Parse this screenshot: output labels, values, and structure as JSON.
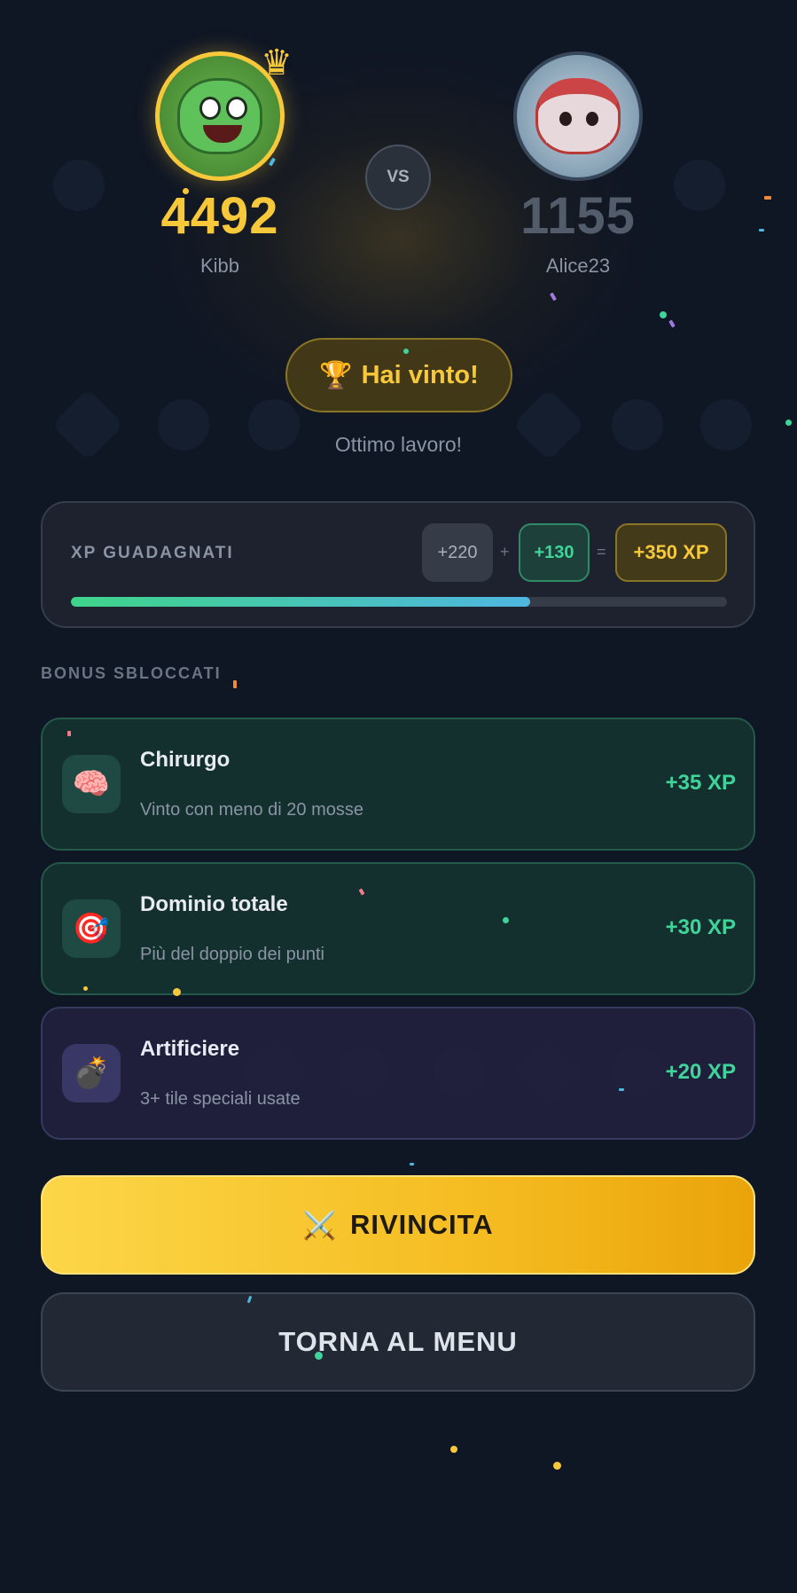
{
  "players": [
    {
      "name": "Kibb",
      "score": "4492",
      "avatar_icon": "frog-avatar-icon",
      "winner": true
    },
    {
      "name": "Alice23",
      "score": "1155",
      "avatar_icon": "mushroom-avatar-icon",
      "winner": false
    }
  ],
  "vs_label": "VS",
  "result": {
    "title": "Hai vinto!",
    "subtitle": "Ottimo lavoro!",
    "icon": "trophy-icon"
  },
  "xp": {
    "title": "XP GUADAGNATI",
    "base": "+220",
    "plus": "+",
    "bonus": "+130",
    "equals": "=",
    "total": "+350 XP",
    "progress": 0.7
  },
  "bonus_section": {
    "title": "BONUS SBLOCCATI",
    "items": [
      {
        "title": "Chirurgo",
        "desc": "Vinto con meno di 20 mosse",
        "xp": "+35 XP",
        "icon": "brain-icon",
        "glyph": "🧠",
        "variant": "green"
      },
      {
        "title": "Dominio totale",
        "desc": "Più del doppio dei punti",
        "xp": "+30 XP",
        "icon": "target-icon",
        "glyph": "🎯",
        "variant": "green"
      },
      {
        "title": "Artificiere",
        "desc": "3+ tile speciali usate",
        "xp": "+20 XP",
        "icon": "bomb-icon",
        "glyph": "💣",
        "variant": "purple"
      }
    ]
  },
  "buttons": {
    "rematch": "RIVINCITA",
    "rematch_icon": "⚔️",
    "menu": "TORNA AL MENU"
  },
  "colors": {
    "background": "#0f1624",
    "gold": "#f7c83a",
    "green": "#3fd49a",
    "muted": "#8a94a4"
  }
}
